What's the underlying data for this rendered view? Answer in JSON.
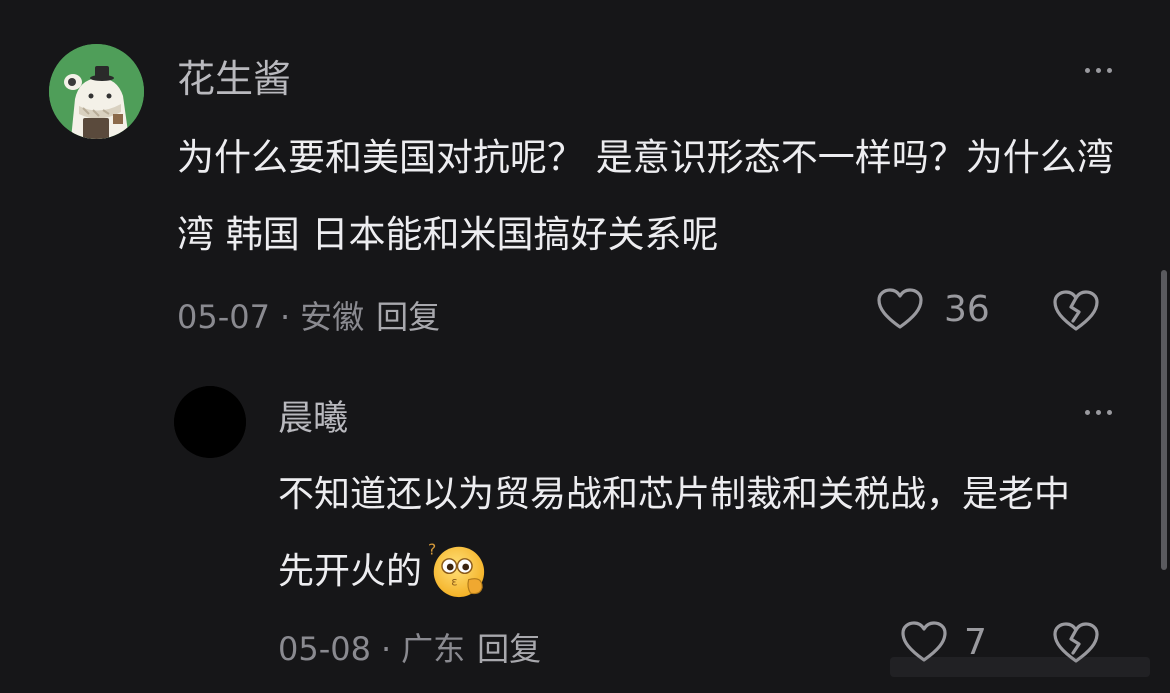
{
  "comments": [
    {
      "author": "花生酱",
      "avatar_icon": "cartoon-avatar",
      "text": "为什么要和美国对抗呢？ 是意识形态不一样吗？为什么湾湾 韩国 日本能和米国搞好关系呢",
      "date": "05-07",
      "separator": "·",
      "location": "安徽",
      "reply_label": "回复",
      "like_count": "36"
    },
    {
      "author": "晨曦",
      "avatar_icon": "black-circle-avatar",
      "text": "不知道还以为贸易战和芯片制裁和关税战，是老中先开火的",
      "emoji": "thinking-kissy-face-emoji",
      "date": "05-08",
      "separator": "·",
      "location": "广东",
      "reply_label": "回复",
      "like_count": "7"
    }
  ],
  "colors": {
    "background": "#161618",
    "text_primary": "#ededf0",
    "text_secondary": "#8a8a90",
    "avatar_green": "#4f9e59"
  },
  "icons": {
    "more": "more-horizontal-icon",
    "like": "heart-outline-icon",
    "dislike": "broken-heart-icon"
  }
}
